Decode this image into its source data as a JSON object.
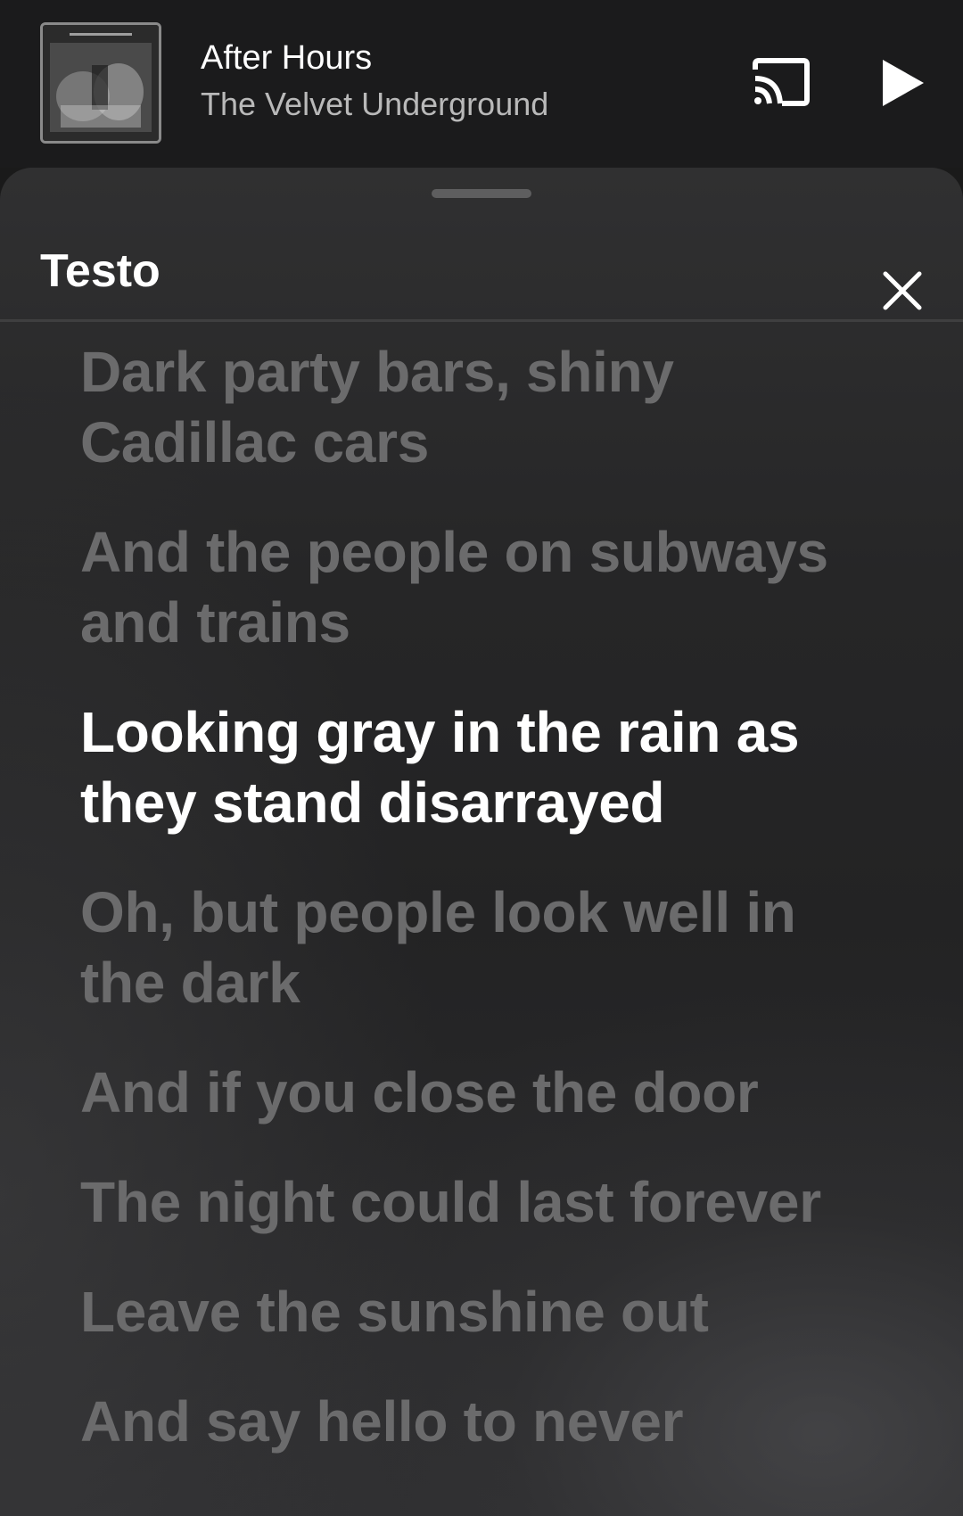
{
  "mini_player": {
    "title": "After Hours",
    "artist": "The Velvet Underground",
    "album_art_icon": "album-cover",
    "cast_icon": "cast-icon",
    "play_icon": "play-icon"
  },
  "lyrics_sheet": {
    "title": "Testo",
    "close_icon": "close-icon",
    "active_index": 2,
    "lines": [
      "Dark party bars, shiny Cadillac cars",
      "And the people on subways and trains",
      "Looking gray in the rain as they stand disarrayed",
      "Oh, but people look well in the dark",
      "And if you close the door",
      "The night could last forever",
      "Leave the sunshine out",
      "And say hello to never"
    ]
  },
  "colors": {
    "background": "#1b1b1c",
    "active_lyric": "#ffffff",
    "inactive_lyric": "#6b6b6c",
    "artist_text": "#b9b9b9"
  }
}
